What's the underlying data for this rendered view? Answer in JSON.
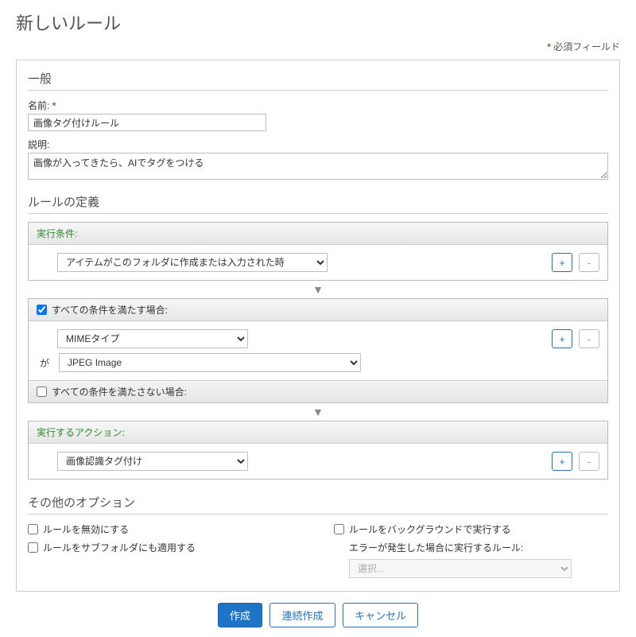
{
  "page": {
    "title": "新しいルール",
    "required_hint": "必須フィールド"
  },
  "general": {
    "heading": "一般",
    "name_label": "名前:",
    "name_value": "画像タグ付けルール",
    "desc_label": "説明:",
    "desc_value": "画像が入ってきたら、AIでタグをつける"
  },
  "definition": {
    "heading": "ルールの定義",
    "when": {
      "label": "実行条件:",
      "selected": "アイテムがこのフォルダに作成または入力された時"
    },
    "if": {
      "all_label": "すべての条件を満たす場合:",
      "criteria_selected": "MIMEタイプ",
      "op_label": "が",
      "value_selected": "JPEG Image",
      "none_label": "すべての条件を満たさない場合:"
    },
    "action": {
      "label": "実行するアクション:",
      "selected": "画像認識タグ付け"
    },
    "btn_plus": "+",
    "btn_minus": "-"
  },
  "other": {
    "heading": "その他のオプション",
    "disable_label": "ルールを無効にする",
    "subfolders_label": "ルールをサブフォルダにも適用する",
    "background_label": "ルールをバックグラウンドで実行する",
    "error_label": "エラーが発生した場合に実行するルール:",
    "error_select_placeholder": "選択..."
  },
  "footer": {
    "create": "作成",
    "create_continue": "連続作成",
    "cancel": "キャンセル"
  }
}
